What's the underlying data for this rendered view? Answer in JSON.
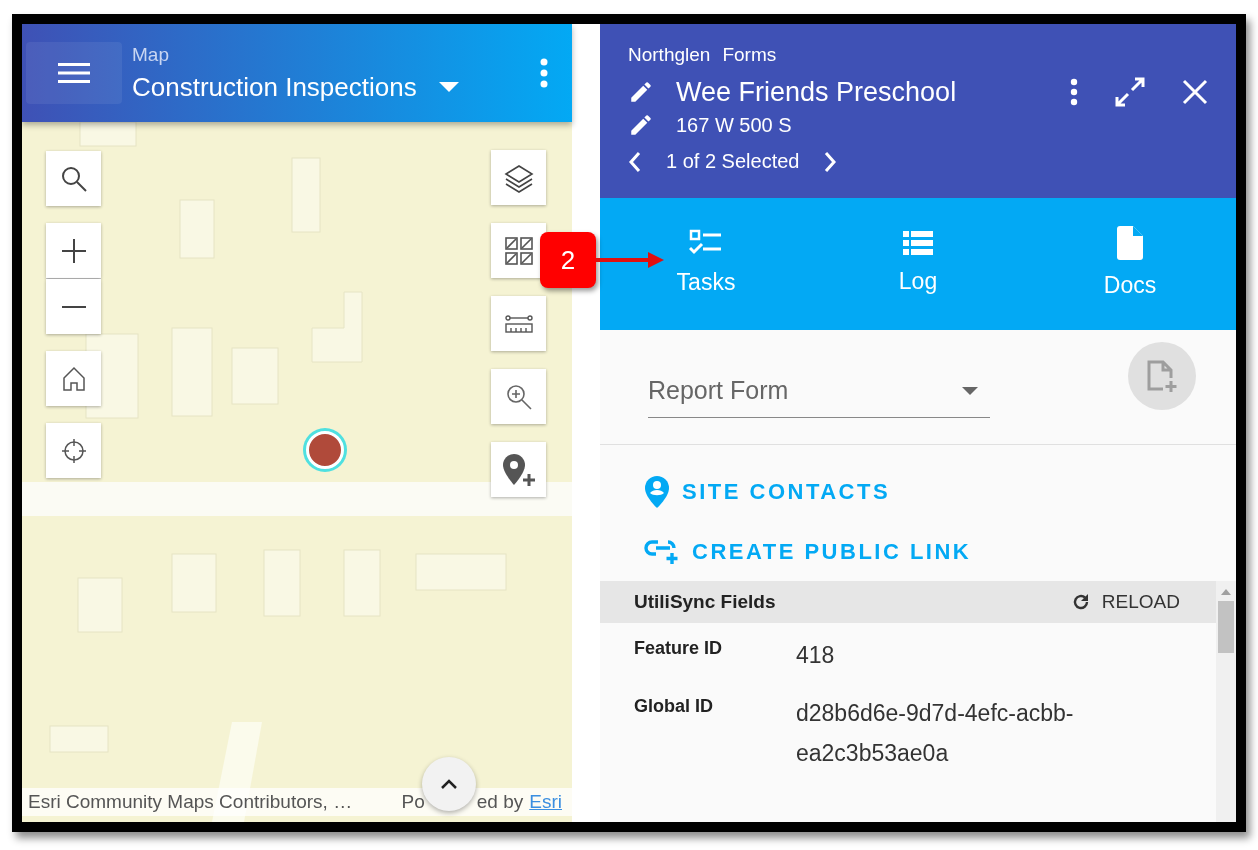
{
  "map": {
    "subtitle": "Map",
    "title": "Construction Inspections",
    "attribution": "Esri Community Maps Contributors, …",
    "powered_start": "Po",
    "powered_end": "ed by",
    "powered_link": "Esri"
  },
  "record": {
    "breadcrumb": [
      "Northglen",
      "Forms"
    ],
    "title": "Wee Friends Preschool",
    "address": "167 W 500 S",
    "selection": "1 of 2 Selected"
  },
  "tabs": [
    {
      "label": "Tasks",
      "kind": "tasks",
      "selected": false
    },
    {
      "label": "Log",
      "kind": "log",
      "selected": false
    },
    {
      "label": "Docs",
      "kind": "docs",
      "selected": false
    }
  ],
  "callout": {
    "label": "2"
  },
  "form_select": {
    "value": "Report Form"
  },
  "actions": [
    {
      "label": "SITE CONTACTS",
      "kind": "contact"
    },
    {
      "label": "CREATE PUBLIC LINK",
      "kind": "link"
    }
  ],
  "fields": {
    "title": "UtiliSync Fields",
    "reload": "RELOAD",
    "rows": [
      {
        "label": "Feature ID",
        "value": "418"
      },
      {
        "label": "Global ID",
        "value": "d28b6d6e-9d7d-4efc-acbb-ea2c3b53ae0a"
      }
    ]
  }
}
